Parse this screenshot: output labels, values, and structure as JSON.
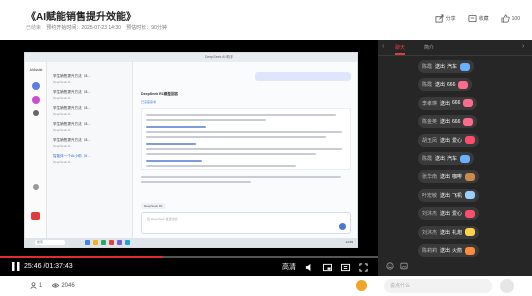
{
  "header": {
    "title": "《AI赋能销售提升效能》",
    "status": "已结束",
    "start_time_label": "预约开始时间：2025-07-23 14:30",
    "duration_label": "预估时长：90分钟",
    "actions": [
      {
        "label": "分享",
        "icon": "share-icon"
      },
      {
        "label": "收藏",
        "icon": "bookmark-icon"
      },
      {
        "label": "100",
        "icon": "like-icon"
      }
    ]
  },
  "screen": {
    "app_name": "DeepSeek AI 助手",
    "rail_logo": "AIAssist",
    "list_items": [
      {
        "title": "学生销售提升方法（8...",
        "sub": "DeepSeek R..."
      },
      {
        "title": "学生销售提升方法（8...",
        "sub": "DeepSeek R..."
      },
      {
        "title": "学生销售提升方法（8...",
        "sub": "DeepSeek R..."
      },
      {
        "title": "学生销售提升方法（8...",
        "sub": "DeepSeek R..."
      },
      {
        "title": "学生销售提升方法（8...",
        "sub": "DeepSeek R..."
      },
      {
        "title": "智能体一个AI小助（8...",
        "sub": "DeepSeek R..."
      }
    ],
    "chat_header": "DeepSeek R1模型回答",
    "chat_tag": "已深度思考",
    "model_pill": "DeepSeek R1",
    "composer_placeholder": "给 DeepSeek 发送消息",
    "taskbar_search": "搜索",
    "taskbar_time": "14:39"
  },
  "player": {
    "current_time": "25:46",
    "total_time": "01:37:43",
    "progress": 0.43,
    "quality": "高清"
  },
  "side": {
    "tabs": [
      "聊天",
      "简介"
    ],
    "active_tab": 0,
    "gifts": [
      {
        "user": "陈霞",
        "verb": "送出",
        "item": "汽车",
        "color": "#6ab0ff"
      },
      {
        "user": "陈霞",
        "verb": "送出",
        "item": "666",
        "color": "#ff6b8a"
      },
      {
        "user": "李孝瑛",
        "verb": "送出",
        "item": "666",
        "color": "#ff6b8a"
      },
      {
        "user": "陈金英",
        "verb": "送出",
        "item": "666",
        "color": "#ff6b8a"
      },
      {
        "user": "胡玉凤",
        "verb": "送出",
        "item": "爱心",
        "color": "#ff4d6d"
      },
      {
        "user": "陈霞",
        "verb": "送出",
        "item": "汽车",
        "color": "#6ab0ff"
      },
      {
        "user": "张华南",
        "verb": "送出",
        "item": "咖啡",
        "color": "#c98a4b"
      },
      {
        "user": "叶宏敏",
        "verb": "送出",
        "item": "飞机",
        "color": "#9ad0ff"
      },
      {
        "user": "刘沐杰",
        "verb": "送出",
        "item": "爱心",
        "color": "#ff4d6d"
      },
      {
        "user": "刘沐杰",
        "verb": "送出",
        "item": "礼炮",
        "color": "#ffd24d"
      },
      {
        "user": "陈莉莉",
        "verb": "送出",
        "item": "火箭",
        "color": "#ff8a3d"
      }
    ]
  },
  "bottom": {
    "viewers_a": "1",
    "viewers_b": "2046",
    "chat_placeholder": "说点什么"
  }
}
